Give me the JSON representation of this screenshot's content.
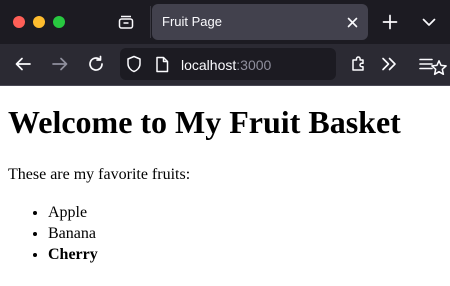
{
  "browser": {
    "window_controls": {
      "close_color": "#ff5f57",
      "minimize_color": "#febc2e",
      "maximize_color": "#28c840"
    },
    "tabs": [
      {
        "title": "Fruit Page",
        "active": true
      }
    ],
    "address_bar": {
      "host": "localhost",
      "port": ":3000"
    }
  },
  "page": {
    "heading": "Welcome to My Fruit Basket",
    "intro": "These are my favorite fruits:",
    "fruits": [
      {
        "name": "Apple",
        "bold": false
      },
      {
        "name": "Banana",
        "bold": false
      },
      {
        "name": "Cherry",
        "bold": true
      }
    ]
  }
}
